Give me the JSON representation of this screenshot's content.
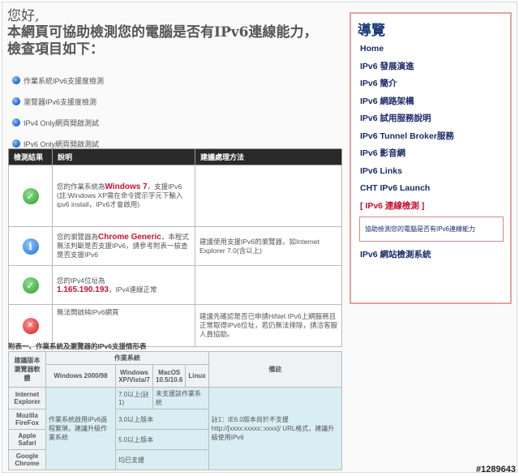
{
  "header": {
    "greeting": "您好,",
    "line1": "本網頁可協助檢測您的電腦是否有IPv6連線能力，",
    "line2": "檢查項目如下："
  },
  "checks": [
    "作業系統IPv6支援度檢測",
    "瀏覽器IPv6支援度檢測",
    "IPv4 Only網頁開啟測試",
    "IPv6 Only網頁開啟測試"
  ],
  "results": {
    "headers": [
      "檢測結果",
      "說明",
      "建議處理方法"
    ],
    "rows": [
      {
        "status": "ok",
        "desc_before": "您的作業系統為",
        "desc_highlight": "Windows 7",
        "desc_after": "，支援IPv6 (註:Windows XP需在命令提示字元下輸入ipv6 install，IPv6才會啟用)",
        "advice": ""
      },
      {
        "status": "info",
        "desc_before": "您的瀏覽器為",
        "desc_highlight": "Chrome Generic",
        "desc_after": "，本程式無法判斷是否支援IPv6，請參考附表一檢查是否支援IPv6",
        "advice": "建議使用支援IPv6的瀏覽器，如Internet Explorer 7.0(含以上)"
      },
      {
        "status": "ok",
        "desc_before": "您的IPv4位址為",
        "desc_highlight": "1.165.190.193",
        "desc_after": "，IPv4連線正常",
        "advice": ""
      },
      {
        "status": "err",
        "desc_before": "無法開啟純IPv6網頁",
        "desc_highlight": "",
        "desc_after": "",
        "advice": "建議先確認是否已申請HiNet IPv6上網服務且正常取得IPv6位址，若仍無法排除，請洽客服人員協助。"
      }
    ]
  },
  "appendix": {
    "title": "附表一、作業系統及瀏覽器的IPv6支援情形表",
    "corner_header": "建議版本 瀏覽器軟體",
    "os_header": "作業系統",
    "os_cols": [
      "Windows 2000/98",
      "Windows XP/Vista/7",
      "MacOS 10.5/10.6",
      "Linux"
    ],
    "note_header": "備註",
    "browsers": [
      "Internet Explorer",
      "Mozilla FireFox",
      "Apple Safari",
      "Google Chrome"
    ],
    "win2000_text": "作業系統啟用IPv6過程繁瑣，建議升級作業系統",
    "ie_xp": "7.0以上(註1)",
    "ie_mac": "未支援該作業系統",
    "firefox": "3.0以上版本",
    "safari": "5.0以上版本",
    "chrome": "均已支援",
    "note": "註1：IE6.0版本尚於不支援http://[xxxx:xxxxx::xxxx]/ URL格式，建議升級使用IPv6"
  },
  "sidebar": {
    "title": "導覽",
    "items": [
      "Home",
      "IPv6 發展演進",
      "IPv6 簡介",
      "IPv6 網路架構",
      "IPv6 試用服務說明",
      "IPv6 Tunnel Broker服務",
      "IPv6 影音網",
      "IPv6 Links",
      "CHT IPv6 Launch",
      "[ IPv6 連線檢測 ]"
    ],
    "sub_item": "協助檢測您的電腦是否有IPv6連線能力",
    "last_item": "IPv6 網站檢測系統"
  },
  "watermark": "#1289643",
  "colors": {
    "accent_red": "#c8102e",
    "nav_blue": "#1a2a6a",
    "sidebar_border": "#e8a0a0"
  }
}
